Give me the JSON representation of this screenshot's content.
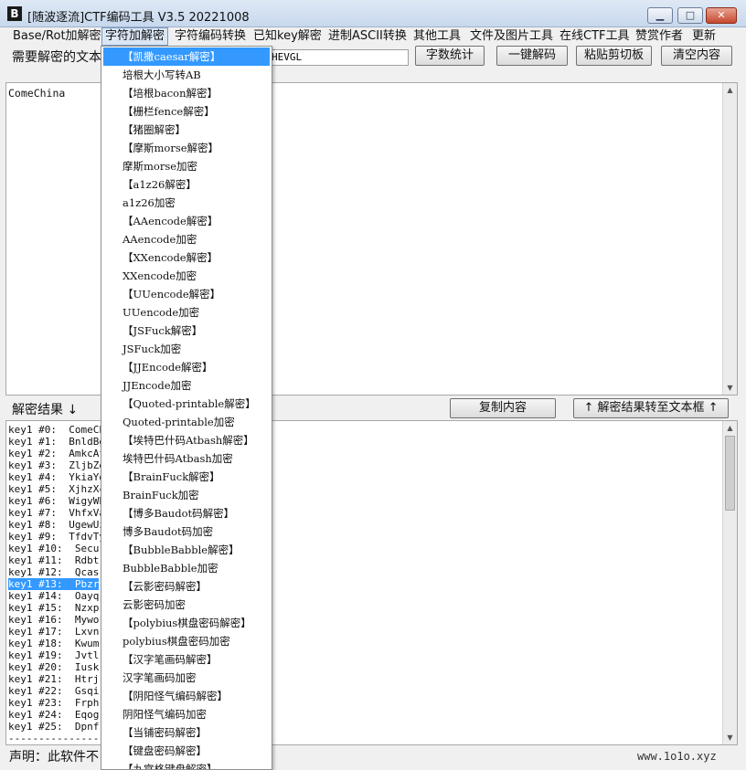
{
  "window": {
    "app_icon_glyph": "B",
    "title": "[随波逐流]CTF编码工具 V3.5 20221008",
    "min_glyph": "▁",
    "max_glyph": "□",
    "close_glyph": "✕"
  },
  "menubar": [
    "Base/Rot加解密",
    "字符加解密",
    "字符编码转换",
    "已知key解密",
    "进制ASCII转换",
    "其他工具",
    "文件及图片工具",
    "在线CTF工具",
    "赞赏作者",
    "更新"
  ],
  "input": {
    "label": "需要解密的文本",
    "key_value": "HEVGL",
    "text": "ComeChina"
  },
  "toolbar": {
    "count_label": "字数统计",
    "one_click_label": "一键解码",
    "paste_label": "粘贴剪切板",
    "clear_label": "清空内容"
  },
  "result": {
    "label": "解密结果 ↓",
    "copy_label": "复制内容",
    "transfer_label": "↑ 解密结果转至文本框 ↑",
    "lines": [
      "key1 #0:  ComeCh",
      "key1 #1:  BnldBg",
      "key1 #2:  AmkcAf",
      "key1 #3:  ZljbZe",
      "key1 #4:  YkiaYd",
      "key1 #5:  XjhzXc",
      "key1 #6:  WigyWb",
      "key1 #7:  VhfxVa",
      "key1 #8:  UgewUz",
      "key1 #9:  TfdvTy",
      "key1 #10:  Secu",
      "key1 #11:  Rdbt",
      "key1 #12:  Qcas",
      "key1 #13:  Pbzr",
      "key1 #14:  Oayq",
      "key1 #15:  Nzxp",
      "key1 #16:  Mywo",
      "key1 #17:  Lxvn",
      "key1 #18:  Kwum",
      "key1 #19:  Jvtl",
      "key1 #20:  Iusk",
      "key1 #21:  Htrj",
      "key1 #22:  Gsqi",
      "key1 #23:  Frph",
      "key1 #24:  Eqog",
      "key1 #25:  Dpnf",
      "-----------------"
    ],
    "selected_index": 13
  },
  "status": {
    "disclaimer": "声明：此软件不",
    "watermark": "www.1o1o.xyz"
  },
  "dropdown": {
    "selected_index": 0,
    "items": [
      "【凯撒caesar解密】",
      "培根大小写转AB",
      "【培根bacon解密】",
      "【栅栏fence解密】",
      "【猪圈解密】",
      "【摩斯morse解密】",
      "摩斯morse加密",
      "【a1z26解密】",
      "a1z26加密",
      "【AAencode解密】",
      "AAencode加密",
      "【XXencode解密】",
      "XXencode加密",
      "【UUencode解密】",
      "UUencode加密",
      "【JSFuck解密】",
      "JSFuck加密",
      "【JJEncode解密】",
      "JJEncode加密",
      "【Quoted-printable解密】",
      "Quoted-printable加密",
      "【埃特巴什码Atbash解密】",
      "埃特巴什码Atbash加密",
      "【BrainFuck解密】",
      "BrainFuck加密",
      "【博多Baudot码解密】",
      "博多Baudot码加密",
      "【BubbleBabble解密】",
      "BubbleBabble加密",
      "【云影密码解密】",
      "云影密码加密",
      "【polybius棋盘密码解密】",
      "polybius棋盘密码加密",
      "【汉字笔画码解密】",
      "汉字笔画码加密",
      "【阴阳怪气编码解密】",
      "阴阳怪气编码加密",
      "【当铺密码解密】",
      "【键盘密码解密】",
      "【九宫格键盘解密】"
    ]
  }
}
